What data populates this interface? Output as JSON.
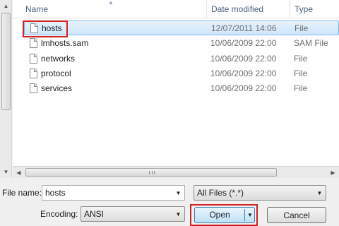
{
  "columns": {
    "name": "Name",
    "date_modified": "Date modified",
    "type": "Type"
  },
  "files": [
    {
      "name": "hosts",
      "date": "12/07/2011 14:06",
      "type": "File",
      "selected": true
    },
    {
      "name": "lmhosts.sam",
      "date": "10/06/2009 22:00",
      "type": "SAM File",
      "selected": false
    },
    {
      "name": "networks",
      "date": "10/06/2009 22:00",
      "type": "File",
      "selected": false
    },
    {
      "name": "protocol",
      "date": "10/06/2009 22:00",
      "type": "File",
      "selected": false
    },
    {
      "name": "services",
      "date": "10/06/2009 22:00",
      "type": "File",
      "selected": false
    }
  ],
  "form": {
    "file_name_label": "File name:",
    "file_name_value": "hosts",
    "filter_value": "All Files  (*.*)",
    "encoding_label": "Encoding:",
    "encoding_value": "ANSI"
  },
  "buttons": {
    "open": "Open",
    "cancel": "Cancel"
  },
  "colors": {
    "highlight": "#d42020",
    "selection": "#cfe6fa",
    "header_text": "#4c607a"
  }
}
